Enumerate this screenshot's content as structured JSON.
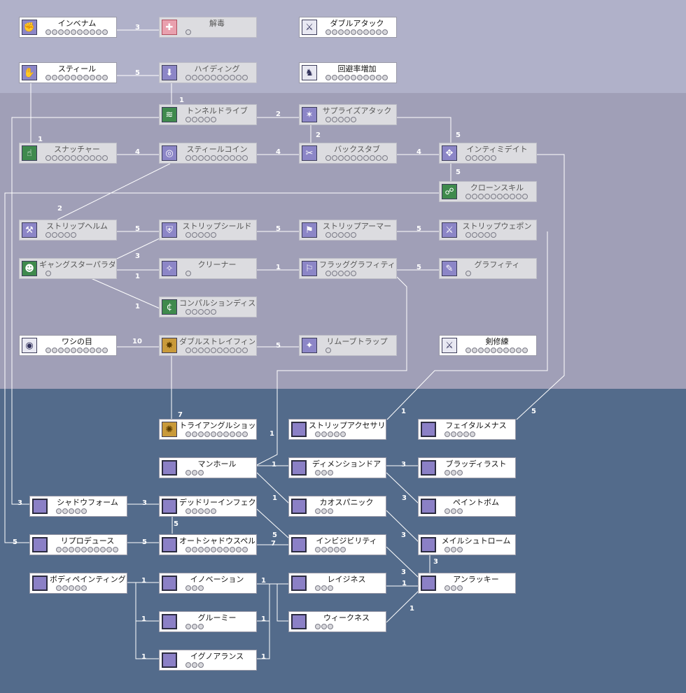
{
  "colors": {
    "band_top": "#b0b1c9",
    "band_middle": "#a09fb7",
    "band_bottom": "#536b8b",
    "connector": "#ffffff"
  },
  "skills": [
    {
      "id": "invenom",
      "name": "インベナム",
      "max_level": 10,
      "style": "normal",
      "icon": "poison-fist-icon"
    },
    {
      "id": "detoxify",
      "name": "解毒",
      "max_level": 1,
      "style": "dim",
      "icon": "heart-cross-icon"
    },
    {
      "id": "double-attack",
      "name": "ダブルアタック",
      "max_level": 10,
      "style": "normal",
      "icon": "double-blade-icon"
    },
    {
      "id": "steal",
      "name": "スティール",
      "max_level": 10,
      "style": "normal",
      "icon": "steal-hand-icon"
    },
    {
      "id": "hiding",
      "name": "ハイディング",
      "max_level": 10,
      "style": "dim",
      "icon": "hiding-icon"
    },
    {
      "id": "improve-flee",
      "name": "回避率増加",
      "max_level": 10,
      "style": "normal",
      "icon": "evasion-icon"
    },
    {
      "id": "tunnel-drive",
      "name": "トンネルドライブ",
      "max_level": 5,
      "style": "dim",
      "icon": "tunnel-icon"
    },
    {
      "id": "surprise-attack",
      "name": "サプライズアタック",
      "max_level": 5,
      "style": "dim",
      "icon": "surprise-icon"
    },
    {
      "id": "snatcher",
      "name": "スナッチャー",
      "max_level": 10,
      "style": "dim",
      "icon": "snatch-icon"
    },
    {
      "id": "steal-coin",
      "name": "スティールコイン",
      "max_level": 10,
      "style": "dim",
      "icon": "coin-icon"
    },
    {
      "id": "backstab",
      "name": "バックスタブ",
      "max_level": 10,
      "style": "dim",
      "icon": "backstab-icon"
    },
    {
      "id": "intimidate",
      "name": "インティミデイト",
      "max_level": 5,
      "style": "dim",
      "icon": "intimidate-icon"
    },
    {
      "id": "clone-skill",
      "name": "クローンスキル",
      "max_level": 10,
      "style": "dim",
      "icon": "clone-icon"
    },
    {
      "id": "strip-helm",
      "name": "ストリップヘルム",
      "max_level": 5,
      "style": "dim",
      "icon": "strip-helm-icon"
    },
    {
      "id": "strip-shield",
      "name": "ストリップシールド",
      "max_level": 5,
      "style": "dim",
      "icon": "strip-shield-icon"
    },
    {
      "id": "strip-armor",
      "name": "ストリップアーマー",
      "max_level": 5,
      "style": "dim",
      "icon": "strip-armor-icon"
    },
    {
      "id": "strip-weapon",
      "name": "ストリップウェポン",
      "max_level": 5,
      "style": "dim",
      "icon": "strip-weapon-icon"
    },
    {
      "id": "gangster-paradise",
      "name": "ギャングスターパラダイス",
      "max_level": 1,
      "style": "dim",
      "icon": "gangster-icon"
    },
    {
      "id": "cleaner",
      "name": "クリーナー",
      "max_level": 1,
      "style": "dim",
      "icon": "cleaner-icon"
    },
    {
      "id": "flag-graffiti",
      "name": "フラッググラフィティ",
      "max_level": 5,
      "style": "dim",
      "icon": "flag-graffiti-icon"
    },
    {
      "id": "graffiti",
      "name": "グラフィティ",
      "max_level": 1,
      "style": "dim",
      "icon": "graffiti-icon"
    },
    {
      "id": "compulsion-discount",
      "name": "コンパルションディスカウント",
      "max_level": 5,
      "style": "dim",
      "icon": "discount-icon"
    },
    {
      "id": "vultures-eye",
      "name": "ワシの目",
      "max_level": 10,
      "style": "normal",
      "icon": "eagle-eye-icon"
    },
    {
      "id": "double-strafe",
      "name": "ダブルストレイフィング",
      "max_level": 10,
      "style": "dim",
      "icon": "double-strafe-icon"
    },
    {
      "id": "remove-trap",
      "name": "リムーブトラップ",
      "max_level": 1,
      "style": "dim",
      "icon": "remove-trap-icon"
    },
    {
      "id": "sword-mastery",
      "name": "剣修練",
      "max_level": 10,
      "style": "normal",
      "icon": "sword-icon"
    },
    {
      "id": "triangle-shot",
      "name": "トライアングルショット",
      "max_level": 10,
      "style": "normal",
      "icon": "triangle-shot-icon"
    },
    {
      "id": "strip-accessory",
      "name": "ストリップアクセサリー",
      "max_level": 5,
      "style": "normal",
      "icon": "empty-skill-icon"
    },
    {
      "id": "fatal-menace",
      "name": "フェイタルメナス",
      "max_level": 5,
      "style": "normal",
      "icon": "empty-skill-icon"
    },
    {
      "id": "manhole",
      "name": "マンホール",
      "max_level": 3,
      "style": "normal",
      "icon": "empty-skill-icon"
    },
    {
      "id": "dimension-door",
      "name": "ディメンションドア",
      "max_level": 3,
      "style": "normal",
      "icon": "empty-skill-icon"
    },
    {
      "id": "bloody-lust",
      "name": "ブラッディラスト",
      "max_level": 3,
      "style": "normal",
      "icon": "empty-skill-icon"
    },
    {
      "id": "shadow-form",
      "name": "シャドウフォーム",
      "max_level": 5,
      "style": "normal",
      "icon": "empty-skill-icon"
    },
    {
      "id": "deadly-infect",
      "name": "デッドリーインフェクト",
      "max_level": 5,
      "style": "normal",
      "icon": "empty-skill-icon"
    },
    {
      "id": "chaos-panic",
      "name": "カオスパニック",
      "max_level": 3,
      "style": "normal",
      "icon": "empty-skill-icon"
    },
    {
      "id": "paint-bomb",
      "name": "ペイントボム",
      "max_level": 3,
      "style": "normal",
      "icon": "empty-skill-icon"
    },
    {
      "id": "reproduce",
      "name": "リプロデュース",
      "max_level": 10,
      "style": "normal",
      "icon": "empty-skill-icon"
    },
    {
      "id": "auto-shadow-spell",
      "name": "オートシャドウスペル",
      "max_level": 10,
      "style": "normal",
      "icon": "empty-skill-icon"
    },
    {
      "id": "invisibility",
      "name": "インビジビリティ",
      "max_level": 5,
      "style": "normal",
      "icon": "empty-skill-icon"
    },
    {
      "id": "maelstrom",
      "name": "メイルシュトローム",
      "max_level": 3,
      "style": "normal",
      "icon": "empty-skill-icon"
    },
    {
      "id": "body-painting",
      "name": "ボディペインティング",
      "max_level": 5,
      "style": "normal",
      "icon": "empty-skill-icon"
    },
    {
      "id": "enervation",
      "name": "イノベーション",
      "max_level": 3,
      "style": "normal",
      "icon": "empty-skill-icon"
    },
    {
      "id": "laziness",
      "name": "レイジネス",
      "max_level": 3,
      "style": "normal",
      "icon": "empty-skill-icon"
    },
    {
      "id": "unlucky",
      "name": "アンラッキー",
      "max_level": 3,
      "style": "normal",
      "icon": "empty-skill-icon"
    },
    {
      "id": "groomy",
      "name": "グルーミー",
      "max_level": 3,
      "style": "normal",
      "icon": "empty-skill-icon"
    },
    {
      "id": "weakness",
      "name": "ウィークネス",
      "max_level": 3,
      "style": "normal",
      "icon": "empty-skill-icon"
    },
    {
      "id": "ignorance",
      "name": "イグノアランス",
      "max_level": 3,
      "style": "normal",
      "icon": "empty-skill-icon"
    }
  ],
  "link_levels": {
    "invenom-detoxify": "3",
    "steal-hiding": "5",
    "hiding-tunnel": "1",
    "steal-snatcher": "1",
    "tunnel-surprise": "2",
    "backstab-surprise": "2",
    "surprise-intimidate": "5",
    "snatcher-stealcoin": "4",
    "stealcoin-backstab": "4",
    "backstab-intimidate": "4",
    "intimidate-clone": "5",
    "stealcoin-striphelm": "2",
    "striphelm-stripshield": "5",
    "stripshield-striparmor": "5",
    "striparmor-stripweapon": "5",
    "stripshield-gangster": "3",
    "gangster-cleaner": "1",
    "cleaner-flag": "1",
    "flag-graffiti": "5",
    "gangster-compulsion": "1",
    "eagle-doublestrafe": "10",
    "doublestrafe-removetrap": "5",
    "doublestrafe-triangle": "7",
    "stripweapon-stripaccessory": "1",
    "intimidate-fatal": "5",
    "flag-manhole": "1",
    "manhole-dimension": "1",
    "dimension-bloody": "3",
    "manhole-chaos": "1",
    "dimension-paint": "3",
    "tunnel-shadowform": "3",
    "shadowform-deadly": "3",
    "autoshadow-deadly": "5",
    "deadly-invisibility": "5",
    "chaos-maelstrom": "3",
    "clone-reproduce": "5",
    "reproduce-autoshadow": "5",
    "autoshadow-invisibility": "7",
    "unlucky-maelstrom": "3",
    "unlucky-invisibility": "3",
    "body-enervation": "1",
    "body-groomy": "1",
    "body-ignorance": "1",
    "branch-laziness": "1",
    "branch-weakness": "1",
    "branch-mid": "1",
    "laziness-unlucky": "1",
    "weakness-unlucky": "1"
  }
}
